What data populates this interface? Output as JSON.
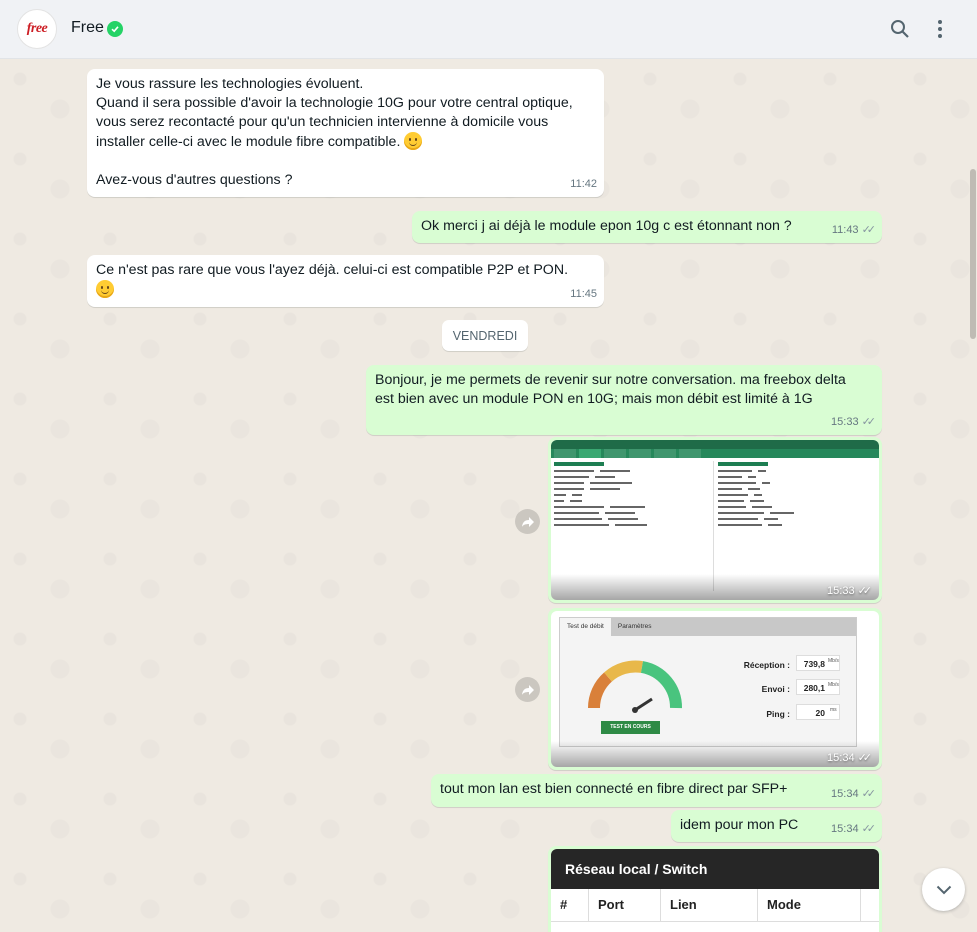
{
  "header": {
    "avatar_text": "free",
    "contact_name": "Free"
  },
  "messages": [
    {
      "id": "m1",
      "text": "Je vous rassure les technologies évoluent.\nQuand il sera possible d'avoir la technologie 10G pour votre central optique,\nvous serez recontacté pour qu'un technicien intervienne à domicile vous\ninstaller celle-ci avec le module fibre compatible. ",
      "text2": "\nAvez-vous d'autres questions ?",
      "time": "11:42"
    },
    {
      "id": "m2",
      "text": "Ok merci j ai déjà le module epon 10g c est étonnant non ?",
      "time": "11:43"
    },
    {
      "id": "m3",
      "text": "Ce n'est pas rare que vous l'ayez déjà. celui-ci est compatible P2P et PON.",
      "time": "11:45"
    },
    {
      "id": "m4",
      "text": "Bonjour, je me permets de revenir sur notre conversation. ma freebox delta\nest bien avec un module PON en 10G; mais mon débit est limité à 1G",
      "time": "15:33"
    },
    {
      "id": "m5",
      "time": "15:33"
    },
    {
      "id": "m6",
      "time": "15:34"
    },
    {
      "id": "m7",
      "text": "tout mon lan est bien connecté en fibre direct par SFP+",
      "time": "15:34"
    },
    {
      "id": "m8",
      "text": "idem pour mon PC",
      "time": "15:34"
    }
  ],
  "day_separator": "VENDREDI",
  "speedtest": {
    "tab_active": "Test de débit",
    "tab_other": "Paramètres",
    "reception_label": "Réception :",
    "reception_value": "739,8",
    "reception_unit": "Mb/s",
    "envoi_label": "Envoi :",
    "envoi_value": "280,1",
    "envoi_unit": "Mb/s",
    "ping_label": "Ping :",
    "ping_value": "20",
    "ping_unit": "ms",
    "button": "TEST EN COURS"
  },
  "switch_table": {
    "title": "Réseau local / Switch",
    "columns": [
      "#",
      "Port",
      "Lien",
      "Mode"
    ]
  },
  "colors": {
    "incoming": "#ffffff",
    "outgoing": "#d9fdd3",
    "verified": "#25d366",
    "brand": "#cd1e25"
  }
}
